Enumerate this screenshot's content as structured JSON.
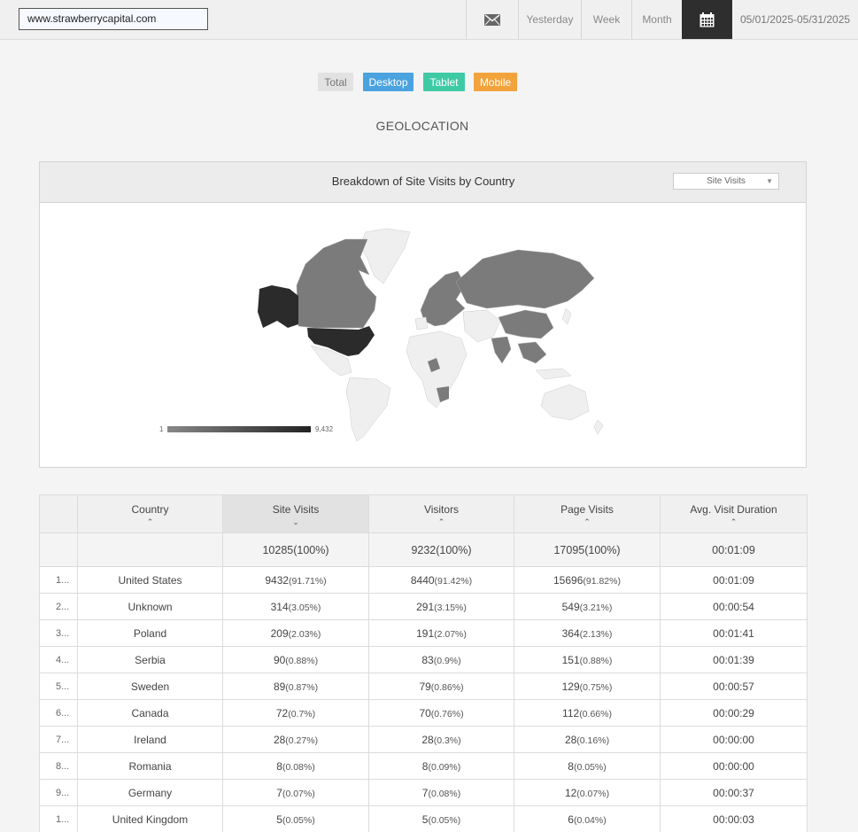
{
  "toolbar": {
    "site": "www.strawberrycapital.com",
    "mail_icon": "mail-icon",
    "yesterday": "Yesterday",
    "week": "Week",
    "month": "Month",
    "calendar_icon": "calendar-icon",
    "date_range": "05/01/2025-05/31/2025"
  },
  "segments": {
    "total": "Total",
    "desktop": "Desktop",
    "tablet": "Tablet",
    "mobile": "Mobile"
  },
  "colors": {
    "desktop": "#4aa3df",
    "tablet": "#3fcaa6",
    "mobile": "#f2a33c",
    "map_high": "#2b2b2b",
    "map_mid": "#7b7b7b",
    "map_none": "#efefef"
  },
  "section_title": "GEOLOCATION",
  "map": {
    "title": "Breakdown of Site Visits by Country",
    "metric_selected": "Site Visits",
    "legend_min": "1",
    "legend_max": "9,432"
  },
  "table": {
    "headers": [
      "Country",
      "Site Visits",
      "Visitors",
      "Page Visits",
      "Avg. Visit Duration"
    ],
    "totals": [
      "10285(100%)",
      "9232(100%)",
      "17095(100%)",
      "00:01:09"
    ],
    "rows": [
      {
        "idx": "1...",
        "country": "United States",
        "sv": "9432",
        "sv_p": "(91.71%)",
        "vi": "8440",
        "vi_p": "(91.42%)",
        "pv": "15696",
        "pv_p": "(91.82%)",
        "dur": "00:01:09"
      },
      {
        "idx": "2...",
        "country": "Unknown",
        "sv": "314",
        "sv_p": "(3.05%)",
        "vi": "291",
        "vi_p": "(3.15%)",
        "pv": "549",
        "pv_p": "(3.21%)",
        "dur": "00:00:54"
      },
      {
        "idx": "3...",
        "country": "Poland",
        "sv": "209",
        "sv_p": "(2.03%)",
        "vi": "191",
        "vi_p": "(2.07%)",
        "pv": "364",
        "pv_p": "(2.13%)",
        "dur": "00:01:41"
      },
      {
        "idx": "4...",
        "country": "Serbia",
        "sv": "90",
        "sv_p": "(0.88%)",
        "vi": "83",
        "vi_p": "(0.9%)",
        "pv": "151",
        "pv_p": "(0.88%)",
        "dur": "00:01:39"
      },
      {
        "idx": "5...",
        "country": "Sweden",
        "sv": "89",
        "sv_p": "(0.87%)",
        "vi": "79",
        "vi_p": "(0.86%)",
        "pv": "129",
        "pv_p": "(0.75%)",
        "dur": "00:00:57"
      },
      {
        "idx": "6...",
        "country": "Canada",
        "sv": "72",
        "sv_p": "(0.7%)",
        "vi": "70",
        "vi_p": "(0.76%)",
        "pv": "112",
        "pv_p": "(0.66%)",
        "dur": "00:00:29"
      },
      {
        "idx": "7...",
        "country": "Ireland",
        "sv": "28",
        "sv_p": "(0.27%)",
        "vi": "28",
        "vi_p": "(0.3%)",
        "pv": "28",
        "pv_p": "(0.16%)",
        "dur": "00:00:00"
      },
      {
        "idx": "8...",
        "country": "Romania",
        "sv": "8",
        "sv_p": "(0.08%)",
        "vi": "8",
        "vi_p": "(0.09%)",
        "pv": "8",
        "pv_p": "(0.05%)",
        "dur": "00:00:00"
      },
      {
        "idx": "9...",
        "country": "Germany",
        "sv": "7",
        "sv_p": "(0.07%)",
        "vi": "7",
        "vi_p": "(0.08%)",
        "pv": "12",
        "pv_p": "(0.07%)",
        "dur": "00:00:37"
      },
      {
        "idx": "1...",
        "country": "United Kingdom",
        "sv": "5",
        "sv_p": "(0.05%)",
        "vi": "5",
        "vi_p": "(0.05%)",
        "pv": "6",
        "pv_p": "(0.04%)",
        "dur": "00:00:03"
      }
    ]
  }
}
